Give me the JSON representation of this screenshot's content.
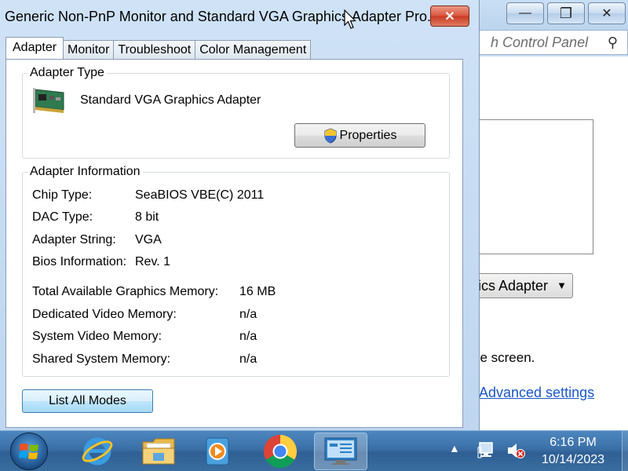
{
  "dialog": {
    "title": "Generic Non-PnP Monitor and Standard VGA Graphics Adapter Pro...",
    "close_glyph": "✕",
    "tabs": [
      {
        "label": "Adapter",
        "active": true
      },
      {
        "label": "Monitor"
      },
      {
        "label": "Troubleshoot"
      },
      {
        "label": "Color Management"
      }
    ],
    "adapter_type": {
      "group_label": "Adapter Type",
      "name": "Standard VGA Graphics Adapter",
      "properties_label": "Properties"
    },
    "adapter_info": {
      "group_label": "Adapter Information",
      "rows": [
        {
          "label": "Chip Type:",
          "value": "SeaBIOS VBE(C) 2011"
        },
        {
          "label": "DAC Type:",
          "value": "8 bit"
        },
        {
          "label": "Adapter String:",
          "value": "VGA"
        },
        {
          "label": "Bios Information:",
          "value": "Rev. 1"
        }
      ],
      "memory_rows": [
        {
          "label": "Total Available Graphics Memory:",
          "value": "16 MB"
        },
        {
          "label": "Dedicated Video Memory:",
          "value": "n/a"
        },
        {
          "label": "System Video Memory:",
          "value": "n/a"
        },
        {
          "label": "Shared System Memory:",
          "value": "n/a"
        }
      ]
    },
    "list_all_modes_label": "List All Modes"
  },
  "background_window": {
    "search_placeholder": "h Control Panel",
    "dropdown_text": "ics Adapter",
    "screen_text": "he screen.",
    "advanced_link": "Advanced settings",
    "min_glyph": "—",
    "max_glyph": "❐",
    "close_glyph": "✕",
    "search_glyph": "⚲",
    "dropdown_arrow": "▼"
  },
  "taskbar": {
    "tray_arrow": "▲",
    "time": "6:16 PM",
    "date": "10/14/2023"
  }
}
